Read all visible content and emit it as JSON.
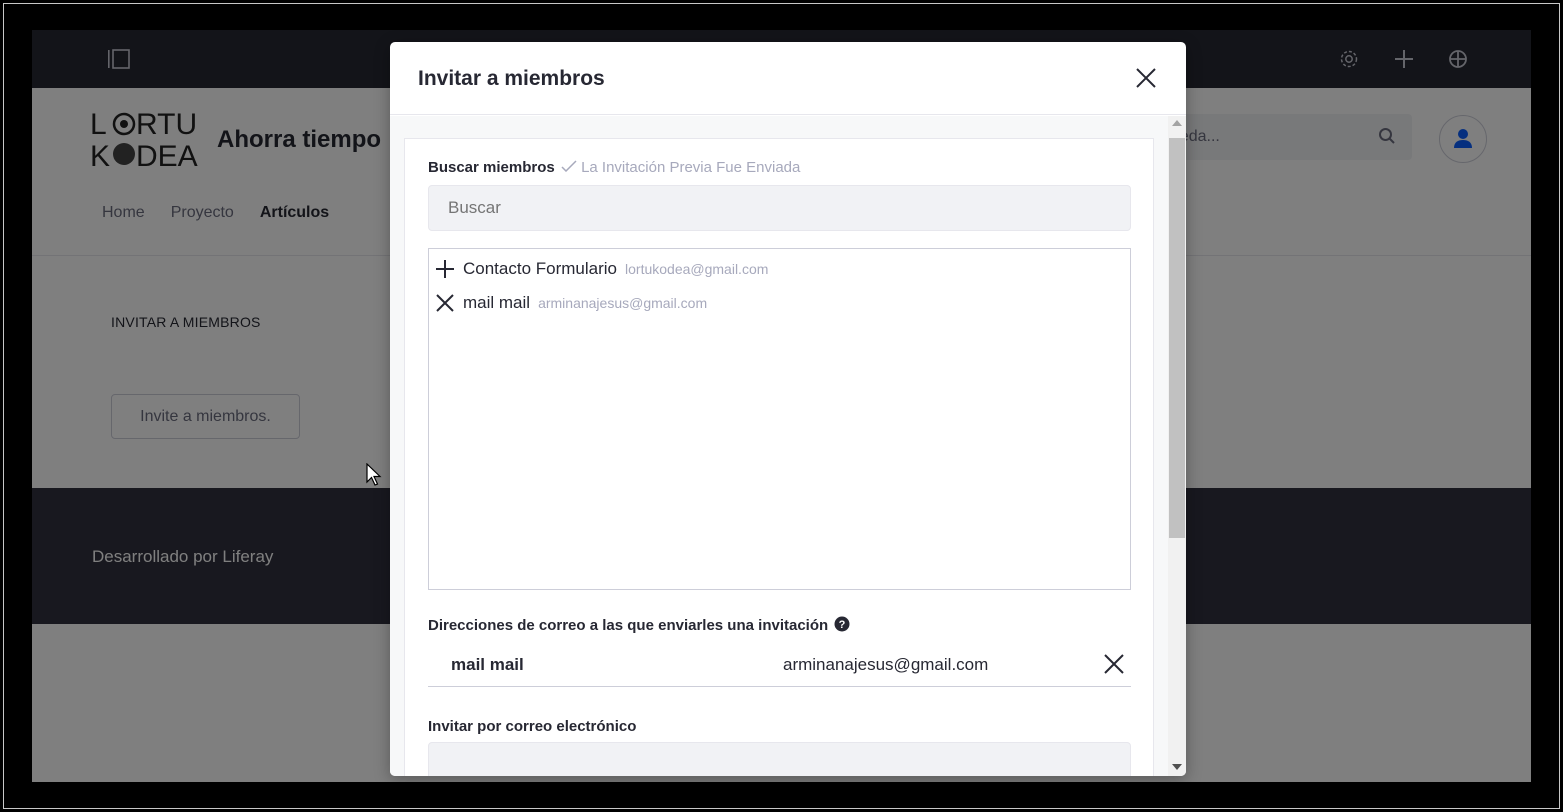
{
  "page": {
    "site_title": "Ahorra tiempo",
    "logo_text": "LORTU KODEA",
    "nav": [
      "Home",
      "Proyecto",
      "Artículos"
    ],
    "search_placeholder": "queda...",
    "portlet_title": "INVITAR A MIEMBROS",
    "invite_button": "Invite a miembros.",
    "footer": "Desarrollado por Liferay"
  },
  "modal": {
    "title": "Invitar a miembros",
    "search_label": "Buscar miembros",
    "search_hint": "La Invitación Previa Fue Enviada",
    "search_placeholder": "Buscar",
    "results": [
      {
        "action": "add",
        "name": "Contacto Formulario",
        "email": "lortukodea@gmail.com"
      },
      {
        "action": "remove",
        "name": "mail mail",
        "email": "arminanajesus@gmail.com"
      }
    ],
    "addresses_label": "Direcciones de correo a las que enviarles una invitación",
    "addresses": [
      {
        "name": "mail mail",
        "email": "arminanajesus@gmail.com"
      }
    ],
    "email_invite_label": "Invitar por correo electrónico"
  },
  "colors": {
    "control_bar": "#272833",
    "footer": "#30313f",
    "accent": "#0b5fff"
  }
}
